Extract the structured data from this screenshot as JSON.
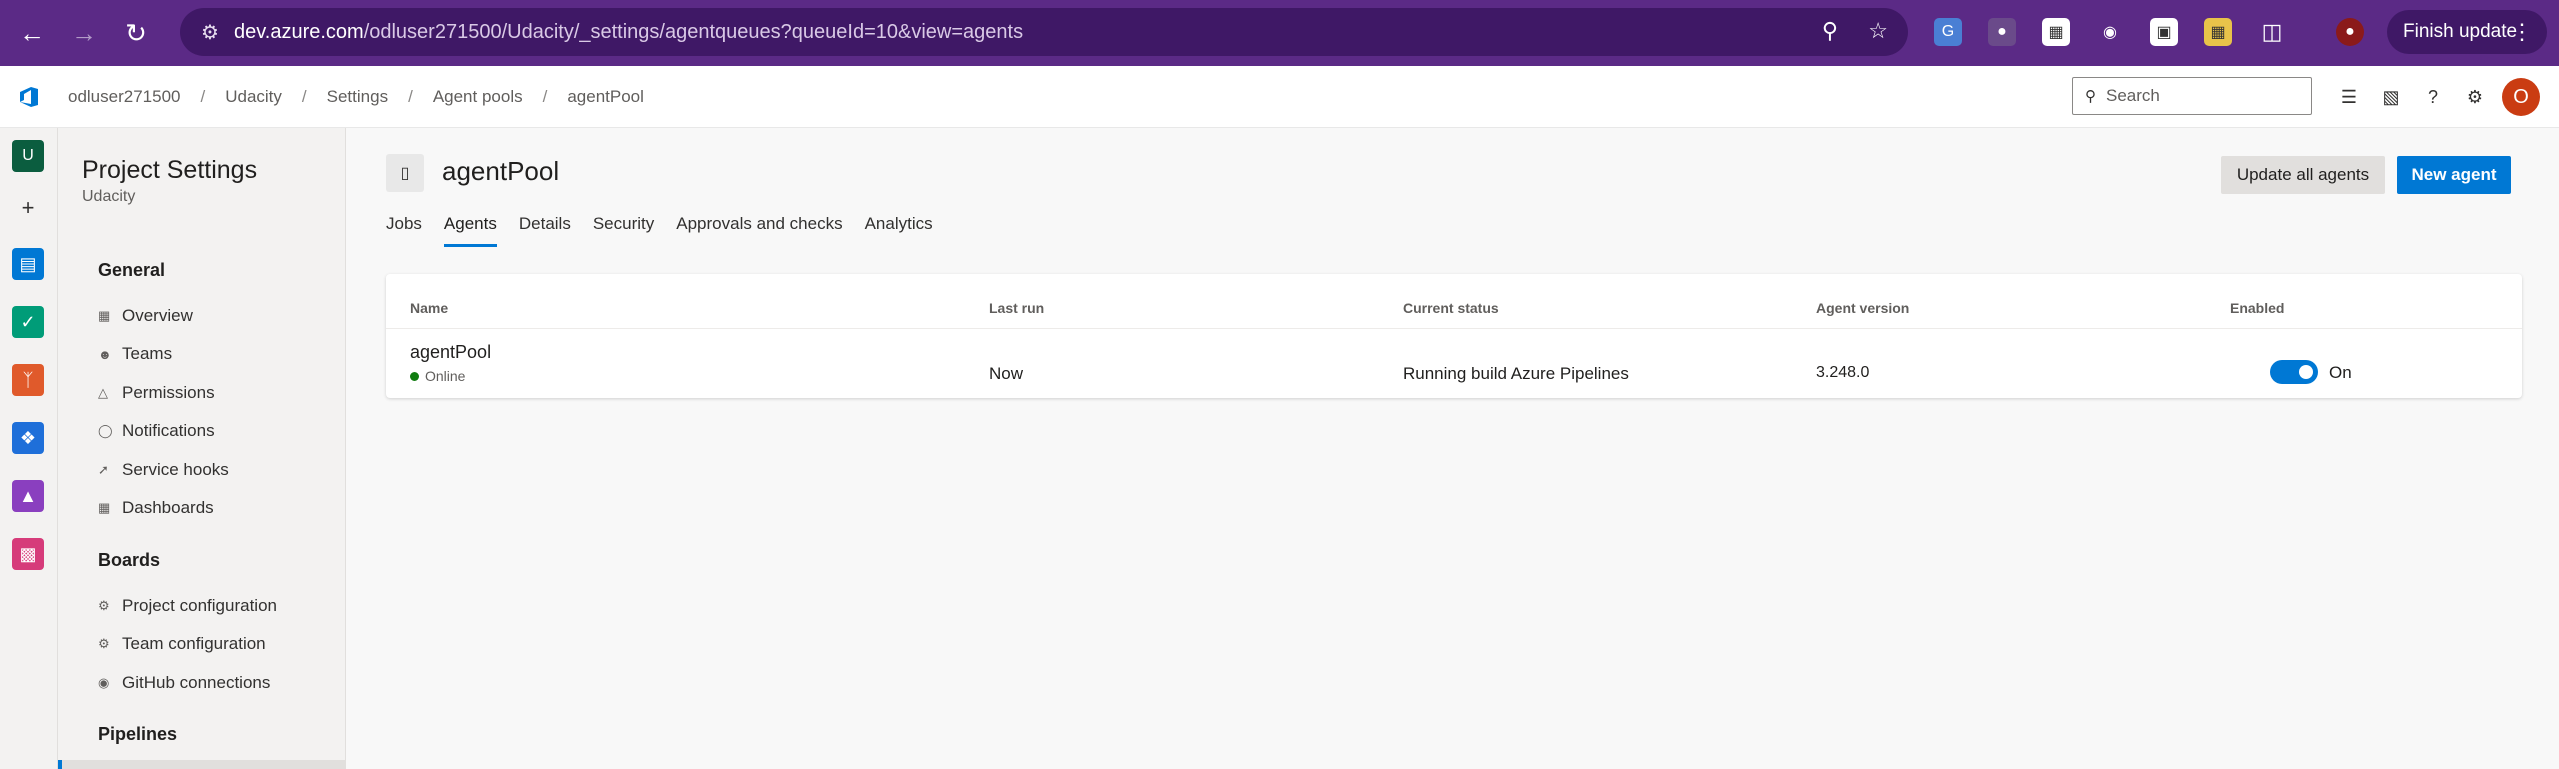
{
  "browser": {
    "url_domain": "dev.azure.com",
    "url_path": "/odluser271500/Udacity/_settings/agentqueues?queueId=10&view=agents",
    "finish_update_label": "Finish update"
  },
  "topbar": {
    "breadcrumb": [
      "odluser271500",
      "Udacity",
      "Settings",
      "Agent pools",
      "agentPool"
    ],
    "search_placeholder": "Search",
    "avatar_initial": "O"
  },
  "rail": {
    "project_initial": "U"
  },
  "settings_nav": {
    "title": "Project Settings",
    "subtitle": "Udacity",
    "groups": [
      {
        "label": "General",
        "items": [
          "Overview",
          "Teams",
          "Permissions",
          "Notifications",
          "Service hooks",
          "Dashboards"
        ]
      },
      {
        "label": "Boards",
        "items": [
          "Project configuration",
          "Team configuration",
          "GitHub connections"
        ]
      },
      {
        "label": "Pipelines",
        "items": []
      }
    ]
  },
  "main": {
    "pool_title": "agentPool",
    "update_all_label": "Update all agents",
    "new_agent_label": "New agent",
    "tabs": [
      "Jobs",
      "Agents",
      "Details",
      "Security",
      "Approvals and checks",
      "Analytics"
    ],
    "active_tab": "Agents",
    "table": {
      "columns": [
        "Name",
        "Last run",
        "Current status",
        "Agent version",
        "Enabled"
      ],
      "rows": [
        {
          "name": "agentPool",
          "status": "Online",
          "last_run": "Now",
          "current_status": "Running build Azure Pipelines",
          "version": "3.248.0",
          "enabled": true,
          "enabled_label": "On"
        }
      ]
    }
  },
  "colors": {
    "browser_frame": "#5b2a86",
    "accent": "#0078d4",
    "online": "#107c10",
    "avatar": "#ca3c12"
  }
}
